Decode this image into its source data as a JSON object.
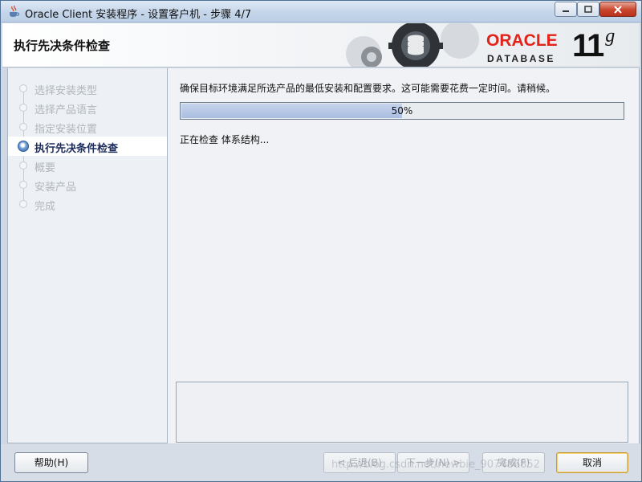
{
  "window": {
    "title": "Oracle Client 安装程序 - 设置客户机 - 步骤 4/7",
    "controls": {
      "minimize": "▭",
      "maximize": "□",
      "close": "✕"
    }
  },
  "header": {
    "title": "执行先决条件检查",
    "logo_oracle": "ORACLE",
    "logo_database": "DATABASE",
    "version_number": "11",
    "version_letter": "g"
  },
  "nav": {
    "steps": [
      {
        "label": "选择安装类型"
      },
      {
        "label": "选择产品语言"
      },
      {
        "label": "指定安装位置"
      },
      {
        "label": "执行先决条件检查"
      },
      {
        "label": "概要"
      },
      {
        "label": "安装产品"
      },
      {
        "label": "完成"
      }
    ]
  },
  "main": {
    "message": "确保目标环境满足所选产品的最低安装和配置要求。这可能需要花费一定时间。请稍候。",
    "progress": {
      "percent": 50,
      "label": "50%"
    },
    "status": "正在检查 体系结构..."
  },
  "footer": {
    "help": "帮助(H)",
    "back": "< 后退(B)",
    "next": "下一步(N) >",
    "finish": "完成(F)",
    "cancel": "取消"
  },
  "watermark": "http://blog.csdn.net/newbie_907486852",
  "colors": {
    "oracle_red": "#e2231a",
    "active_step": "#1b2b5c",
    "progress_fill": "#aabee0"
  }
}
